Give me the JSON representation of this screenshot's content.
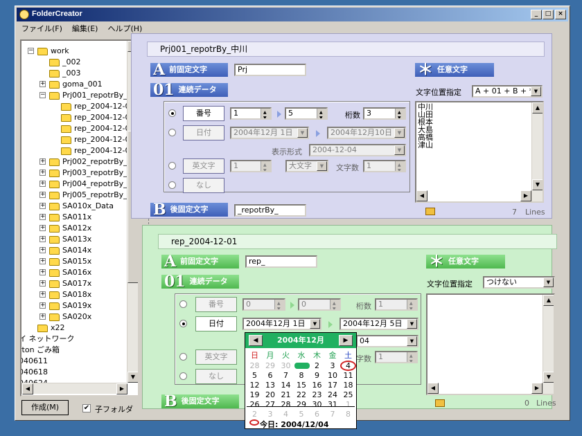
{
  "window": {
    "title": "FolderCreator"
  },
  "menu": [
    "ファイル(F)",
    "編集(E)",
    "ヘルプ(H)"
  ],
  "tree": [
    {
      "label": "work",
      "d": 0,
      "exp": "-"
    },
    {
      "label": "_002",
      "d": 1,
      "exp": ""
    },
    {
      "label": "_003",
      "d": 1,
      "exp": ""
    },
    {
      "label": "goma_001",
      "d": 1,
      "exp": "+"
    },
    {
      "label": "Prj001_repotrBy_中川",
      "d": 1,
      "exp": "-"
    },
    {
      "label": "rep_2004-12-01",
      "d": 2,
      "exp": ""
    },
    {
      "label": "rep_2004-12-02",
      "d": 2,
      "exp": ""
    },
    {
      "label": "rep_2004-12-03",
      "d": 2,
      "exp": ""
    },
    {
      "label": "rep_2004-12-04",
      "d": 2,
      "exp": ""
    },
    {
      "label": "rep_2004-12-05",
      "d": 2,
      "exp": ""
    },
    {
      "label": "Prj002_repotrBy_山田",
      "d": 1,
      "exp": "+"
    },
    {
      "label": "Prj003_repotrBy_根本",
      "d": 1,
      "exp": "+"
    },
    {
      "label": "Prj004_repotrBy_大島",
      "d": 1,
      "exp": "+"
    },
    {
      "label": "Prj005_repotrBy_高橋",
      "d": 1,
      "exp": "+"
    },
    {
      "label": "SA010x_Data",
      "d": 1,
      "exp": "+"
    },
    {
      "label": "SA011x",
      "d": 1,
      "exp": "+"
    },
    {
      "label": "SA012x",
      "d": 1,
      "exp": "+"
    },
    {
      "label": "SA013x",
      "d": 1,
      "exp": "+"
    },
    {
      "label": "SA014x",
      "d": 1,
      "exp": "+"
    },
    {
      "label": "SA015x",
      "d": 1,
      "exp": "+"
    },
    {
      "label": "SA016x",
      "d": 1,
      "exp": "+"
    },
    {
      "label": "SA017x",
      "d": 1,
      "exp": "+"
    },
    {
      "label": "SA018x",
      "d": 1,
      "exp": "+"
    },
    {
      "label": "SA019x",
      "d": 1,
      "exp": "+"
    },
    {
      "label": "SA020x",
      "d": 1,
      "exp": "+"
    },
    {
      "label": "x22",
      "d": 0,
      "exp": ""
    },
    {
      "label": "イ ネットワーク",
      "d": -1,
      "exp": ""
    },
    {
      "label": "rton ごみ箱",
      "d": -1,
      "exp": ""
    },
    {
      "label": "040611",
      "d": -1,
      "exp": ""
    },
    {
      "label": "040618",
      "d": -1,
      "exp": ""
    },
    {
      "label": "040624",
      "d": -1,
      "exp": ""
    }
  ],
  "bottom": {
    "create_button": "作成(M)",
    "subfolder_label": "子フォルダ"
  },
  "p1": {
    "header": "Prj001_repotrBy_中川",
    "prefix": {
      "letter": "A",
      "label": "前固定文字",
      "value": "Prj"
    },
    "serial": {
      "letter": "01",
      "label": "連続データ"
    },
    "number": {
      "btn": "番号",
      "from": "1",
      "to": "5",
      "digits_label": "桁数",
      "digits": "3"
    },
    "date": {
      "btn": "日付",
      "from": "2004年12月 1日",
      "to": "2004年12月10日",
      "fmt_label": "表示形式",
      "fmt": "2004-12-04"
    },
    "alpha": {
      "btn": "英文字",
      "from": "1",
      "case": "大文字",
      "count_label": "文字数",
      "count": "1"
    },
    "none": {
      "btn": "なし"
    },
    "suffix": {
      "letter": "B",
      "label": "後固定文字",
      "value": "_repotrBy_"
    },
    "free": {
      "letter": "＊",
      "label": "任意文字",
      "pos_label": "文字位置指定",
      "pos": "A + 01 + B + *",
      "items": [
        "中川",
        "山田",
        "根本",
        "大島",
        "高橋",
        "津山"
      ],
      "count": "7",
      "lines_label": "Lines"
    }
  },
  "p2": {
    "header": "rep_2004-12-01",
    "prefix": {
      "letter": "A",
      "label": "前固定文字",
      "value": "rep_"
    },
    "serial": {
      "letter": "01",
      "label": "連続データ"
    },
    "number": {
      "btn": "番号",
      "from": "0",
      "to": "0",
      "digits_label": "桁数",
      "digits": "1"
    },
    "date": {
      "btn": "日付",
      "from": "2004年12月 1日",
      "to": "2004年12月 5日",
      "fmt": "04"
    },
    "alpha": {
      "btn": "英文字",
      "count_label": "字数",
      "count": "1"
    },
    "none": {
      "btn": "なし"
    },
    "suffix": {
      "letter": "B",
      "label": "後固定文字"
    },
    "free": {
      "letter": "＊",
      "label": "任意文字",
      "pos_label": "文字位置指定",
      "pos": "つけない",
      "count": "0",
      "lines_label": "Lines"
    }
  },
  "calendar": {
    "title": "2004年12月",
    "weekdays": [
      "日",
      "月",
      "火",
      "水",
      "木",
      "金",
      "土"
    ],
    "days": [
      "28",
      "29",
      "30",
      "1",
      "2",
      "3",
      "4",
      "5",
      "6",
      "7",
      "8",
      "9",
      "10",
      "11",
      "12",
      "13",
      "14",
      "15",
      "16",
      "17",
      "18",
      "19",
      "20",
      "21",
      "22",
      "23",
      "24",
      "25",
      "26",
      "27",
      "28",
      "29",
      "30",
      "31",
      "1",
      "2",
      "3",
      "4",
      "5",
      "6",
      "7",
      "8"
    ],
    "today_label": "今日: 2004/12/04"
  }
}
